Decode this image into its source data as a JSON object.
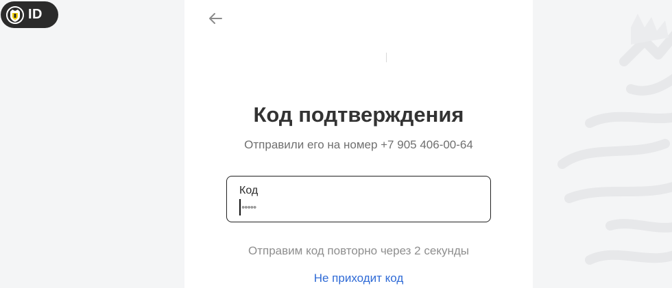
{
  "header": {
    "logo_text": "ID",
    "logo_emblem": "bank-emblem-icon"
  },
  "navigation": {
    "back_icon": "arrow-left-icon"
  },
  "main": {
    "title": "Код подтверждения",
    "subtitle": "Отправили его на номер +7 905 406-00-64",
    "code_field": {
      "label": "Код",
      "placeholder": "•••••",
      "value": ""
    },
    "resend_text": "Отправим код повторно через 2 секунды",
    "no_code_link": "Не приходит код"
  },
  "colors": {
    "background": "#f4f5f6",
    "card": "#ffffff",
    "title": "#333333",
    "link": "#2e6ad6",
    "logo_badge": "#2b2b2b",
    "logo_accent": "#f5d000"
  }
}
